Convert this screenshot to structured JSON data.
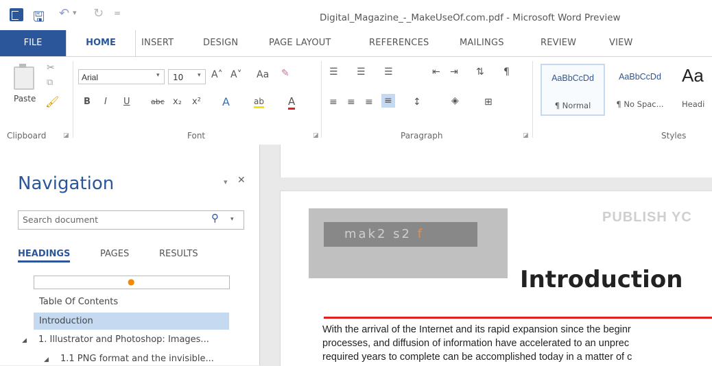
{
  "titlebar": {
    "title": "Digital_Magazine_-_MakeUseOf.com.pdf - Microsoft Word Preview",
    "undo_arrow": "▾",
    "customize": "="
  },
  "ribbon_tabs": [
    "FILE",
    "HOME",
    "INSERT",
    "DESIGN",
    "PAGE LAYOUT",
    "REFERENCES",
    "MAILINGS",
    "REVIEW",
    "VIEW"
  ],
  "clipboard": {
    "paste_label": "Paste",
    "group_label": "Clipboard"
  },
  "font": {
    "name": "Arial",
    "size": "10",
    "group_label": "Font",
    "grow": "A˄",
    "shrink": "A˅",
    "change_case": "Aa",
    "bold": "B",
    "italic": "I",
    "underline": "U",
    "strike": "abc",
    "sub": "x₂",
    "sup": "x²",
    "effects": "A",
    "highlight": "ab",
    "color": "A"
  },
  "paragraph": {
    "group_label": "Paragraph"
  },
  "styles": {
    "group_label": "Styles",
    "items": [
      {
        "preview": "AaBbCcDd",
        "name": "¶ Normal"
      },
      {
        "preview": "AaBbCcDd",
        "name": "¶ No Spac..."
      },
      {
        "preview": "Aa",
        "name": "Headi"
      }
    ]
  },
  "navigation": {
    "title": "Navigation",
    "pin": "▾",
    "close": "✕",
    "search_placeholder": "Search document",
    "tabs": [
      "HEADINGS",
      "PAGES",
      "RESULTS"
    ],
    "marker_dot": "●",
    "items": [
      {
        "label": "Table Of Contents"
      },
      {
        "label": "Introduction"
      },
      {
        "label": "1. Illustrator and Photoshop: Images..."
      },
      {
        "label": "1.1 PNG format and the invisible..."
      }
    ]
  },
  "document": {
    "logo_text": "mak2 s2",
    "logo_suffix": "f",
    "publish_text": "PUBLISH YC",
    "heading": "Introduction",
    "lines": [
      "With the arrival of the Internet and its rapid expansion since the beginr",
      "processes, and diffusion of information have accelerated to an unprec",
      "required years to complete can be accomplished today in a matter of c"
    ]
  },
  "colors": {
    "brand_blue": "#2b579a",
    "accent_red": "#e02020",
    "logo_orange": "#f38b3c"
  }
}
